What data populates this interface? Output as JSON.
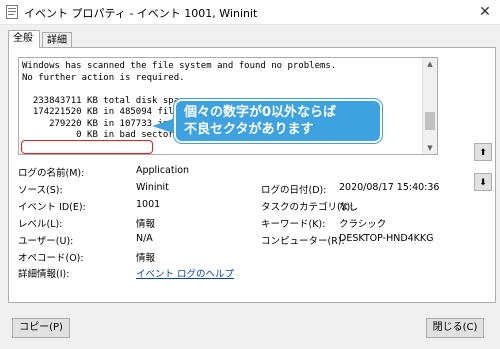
{
  "window": {
    "title": "イベント プロパティ - イベント 1001, Wininit",
    "close_glyph": "✕"
  },
  "tabs": [
    {
      "label": "全般"
    },
    {
      "label": "詳細"
    }
  ],
  "description": {
    "text": "Windows has scanned the file system and found no problems.\nNo further action is required.\n\n  233843711 KB total disk space.\n  174221520 KB in 485094 files.\n     279220 KB in 107733 indexes.\n          0 KB in bad sectors."
  },
  "callout": {
    "text": "個々の数字が0以外ならば\n不良セクタがあります",
    "color": "#3fa2e0"
  },
  "highlight_color": "#e02020",
  "fields": {
    "log_name": {
      "label": "ログの名前(M):",
      "value": "Application"
    },
    "source": {
      "label": "ソース(S):",
      "value": "Wininit"
    },
    "date": {
      "label": "ログの日付(D):",
      "value": "2020/08/17 15:40:36"
    },
    "event_id": {
      "label": "イベント ID(E):",
      "value": "1001"
    },
    "task": {
      "label": "タスクのカテゴリ(Y):",
      "value": "なし"
    },
    "level": {
      "label": "レベル(L):",
      "value": "情報"
    },
    "keyword": {
      "label": "キーワード(K):",
      "value": "クラシック"
    },
    "user": {
      "label": "ユーザー(U):",
      "value": "N/A"
    },
    "computer": {
      "label": "コンピューター(R):",
      "value": "DESKTOP-HND4KKG"
    },
    "opcode": {
      "label": "オペコード(O):",
      "value": "情報"
    },
    "more_info": {
      "label": "詳細情報(I):",
      "value": "イベント ログのヘルプ"
    }
  },
  "nav": {
    "up_glyph": "⬆",
    "down_glyph": "⬇"
  },
  "buttons": {
    "copy": "コピー(P)",
    "close": "閉じる(C)"
  },
  "scroll": {
    "up_glyph": "▲",
    "down_glyph": "▼"
  }
}
